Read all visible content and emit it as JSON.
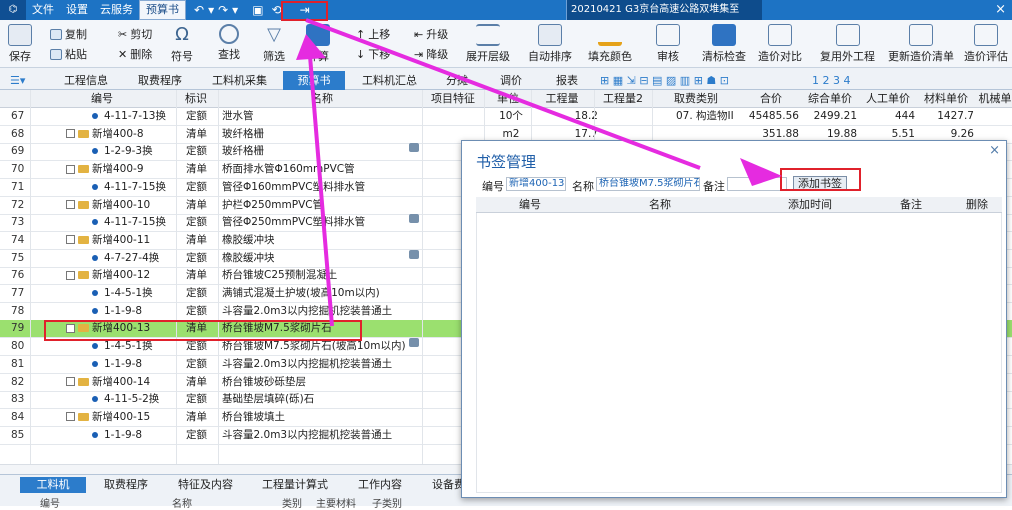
{
  "titlebar": {
    "menu": [
      "文件",
      "设置",
      "云服务",
      "预算书"
    ],
    "active_menu": "预算书",
    "project_title": "20210421  G3京台高速公路双堆集至",
    "window_controls": "×"
  },
  "ribbon": {
    "save": "保存",
    "copy": "复制",
    "paste": "粘贴",
    "cut": "剪切",
    "delete": "删除",
    "symbol": "符号",
    "find": "查找",
    "filter": "筛选",
    "calc": "计算",
    "move_up": "上移",
    "move_down": "下移",
    "upgrade": "升级",
    "downgrade": "降级",
    "expand_level": "展开层级",
    "auto_sort": "自动排序",
    "fill_color": "填充颜色",
    "review": "审核",
    "bill_check": "清标检查",
    "price_compare": "造价对比",
    "reuse_external": "复用外工程",
    "update_price_list": "更新造价清单",
    "price_eval": "造价评估",
    "toolbar_numbers": [
      "1",
      "2",
      "3",
      "4"
    ]
  },
  "tabs": [
    "工程信息",
    "取费程序",
    "工料机采集",
    "预算书",
    "工料机汇总",
    "分摊",
    "调价",
    "报表"
  ],
  "active_tab": "预算书",
  "grid": {
    "headers": [
      "编号",
      "标识",
      "名称",
      "项目特征",
      "单位",
      "工程量",
      "工程量2",
      "取费类别",
      "合价",
      "综合单价",
      "人工单价",
      "材料单价",
      "机械单"
    ],
    "rows": [
      {
        "no": "67",
        "code": "4-11-7-13换",
        "flag": "定额",
        "name": "泄水管",
        "unit": "10个",
        "qty": "18.2",
        "cat": "07. 构造物II",
        "price": "45485.56",
        "comp": "2499.21",
        "lab": "444",
        "mat": "1427.7",
        "level": 2
      },
      {
        "no": "68",
        "code": "新增400-8",
        "flag": "清单",
        "name": "玻纤格栅",
        "unit": "m2",
        "qty": "17.7",
        "cat": "",
        "price": "351.88",
        "comp": "19.88",
        "lab": "5.51",
        "mat": "9.26",
        "level": 1
      },
      {
        "no": "69",
        "code": "1-2-9-3换",
        "flag": "定额",
        "name": "玻纤格栅",
        "level": 2,
        "lock": true
      },
      {
        "no": "70",
        "code": "新增400-9",
        "flag": "清单",
        "name": "桥面排水管Φ160mmPVC管",
        "level": 1
      },
      {
        "no": "71",
        "code": "4-11-7-15换",
        "flag": "定额",
        "name": "管径Φ160mmPVC塑料排水管",
        "level": 2
      },
      {
        "no": "72",
        "code": "新增400-10",
        "flag": "清单",
        "name": "护栏Φ250mmPVC管",
        "level": 1
      },
      {
        "no": "73",
        "code": "4-11-7-15换",
        "flag": "定额",
        "name": "管径Φ250mmPVC塑料排水管",
        "level": 2,
        "lock": true
      },
      {
        "no": "74",
        "code": "新增400-11",
        "flag": "清单",
        "name": "橡胶缓冲块",
        "level": 1
      },
      {
        "no": "75",
        "code": "4-7-27-4换",
        "flag": "定额",
        "name": "橡胶缓冲块",
        "level": 2,
        "lock": true
      },
      {
        "no": "76",
        "code": "新增400-12",
        "flag": "清单",
        "name": "桥台锥坡C25预制混凝土",
        "level": 1
      },
      {
        "no": "77",
        "code": "1-4-5-1换",
        "flag": "定额",
        "name": "满铺式混凝土护坡(坡高10m以内)",
        "level": 2
      },
      {
        "no": "78",
        "code": "1-1-9-8",
        "flag": "定额",
        "name": "斗容量2.0m3以内挖掘机挖装普通土",
        "level": 2
      },
      {
        "no": "79",
        "code": "新增400-13",
        "flag": "清单",
        "name": "桥台锥坡M7.5浆砌片石",
        "level": 1,
        "selected": true
      },
      {
        "no": "80",
        "code": "1-4-5-1换",
        "flag": "定额",
        "name": "桥台锥坡M7.5浆砌片石(坡高10m以内)",
        "level": 2,
        "lock": true
      },
      {
        "no": "81",
        "code": "1-1-9-8",
        "flag": "定额",
        "name": "斗容量2.0m3以内挖掘机挖装普通土",
        "level": 2
      },
      {
        "no": "82",
        "code": "新增400-14",
        "flag": "清单",
        "name": "桥台锥坡砂砾垫层",
        "level": 1
      },
      {
        "no": "83",
        "code": "4-11-5-2换",
        "flag": "定额",
        "name": "基础垫层填碎(砾)石",
        "level": 2
      },
      {
        "no": "84",
        "code": "新增400-15",
        "flag": "清单",
        "name": "桥台锥坡填土",
        "level": 1
      },
      {
        "no": "85",
        "code": "1-1-9-8",
        "flag": "定额",
        "name": "斗容量2.0m3以内挖掘机挖装普通土",
        "level": 2
      }
    ]
  },
  "bottom": {
    "tabs": [
      "工料机",
      "取费程序",
      "特征及内容",
      "工程量计算式",
      "工作内容",
      "设备费"
    ],
    "active": "工料机",
    "headers": [
      "编号",
      "名称",
      "类别",
      "主要材料",
      "子类别"
    ]
  },
  "dialog": {
    "title": "书签管理",
    "close": "×",
    "code_label": "编号",
    "code_value": "新增400-13",
    "name_label": "名称",
    "name_value": "桥台锥坡M7.5浆砌片石",
    "note_label": "备注",
    "note_value": "",
    "add_button": "添加书签",
    "headers": [
      "编号",
      "名称",
      "添加时间",
      "备注",
      "删除"
    ]
  },
  "colors": {
    "title_bar": "#1d73c4",
    "selected_row": "#9be06f",
    "highlight_box": "#e0212b",
    "arrow": "#e52be0"
  }
}
